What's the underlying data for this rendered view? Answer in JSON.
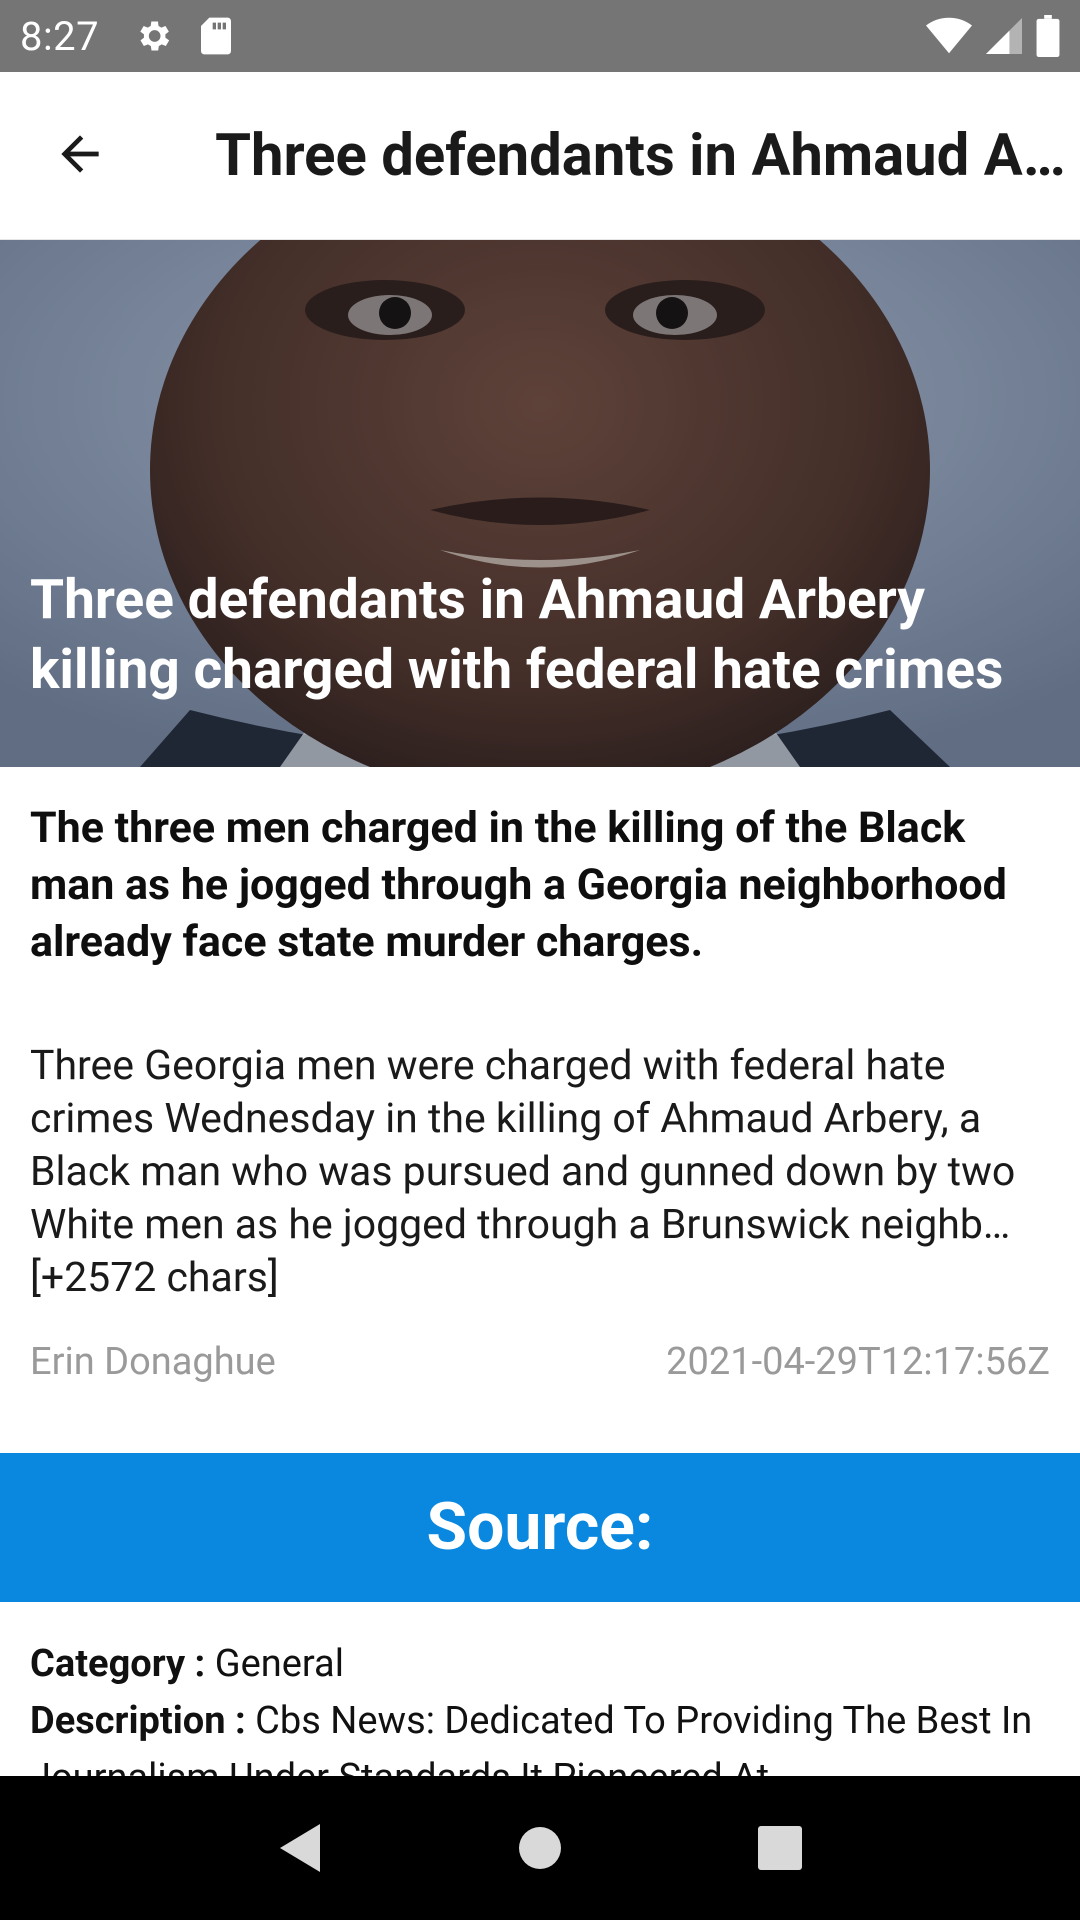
{
  "status_bar": {
    "time": "8:27",
    "icons": [
      "gear-icon",
      "sd-card-icon",
      "wifi-icon",
      "signal-icon",
      "battery-icon"
    ]
  },
  "app_bar": {
    "title": "Three defendants in Ahmaud Arbery killing charged with federal hate crimes",
    "back_icon": "arrow-back-icon"
  },
  "article": {
    "hero_title": "Three defendants in Ahmaud Arbery killing charged with federal hate crimes",
    "summary": "The three men charged in the killing of the Black man as he jogged through a Georgia neighborhood already face state murder charges.",
    "content": "Three Georgia men were charged with federal hate crimes Wednesday in the killing of Ahmaud Arbery, a Black man who was pursued and gunned down by two White men as he jogged through a Brunswick neighb… [+2572 chars]",
    "author": "Erin Donaghue",
    "published_at": "2021-04-29T12:17:56Z"
  },
  "source_button": {
    "label": "Source:"
  },
  "details": {
    "category_label": "Category : ",
    "category_value": "General",
    "description_label": "Description : ",
    "description_value": "Cbs News: Dedicated To Providing The Best In Journalism Under Standards It Pioneered At"
  },
  "colors": {
    "status_bar": "#757575",
    "accent": "#0a88e0",
    "nav_bar": "#000000",
    "meta_text": "#9a9a9a"
  },
  "nav_bar": {
    "buttons": [
      "back-triangle-icon",
      "home-circle-icon",
      "recents-square-icon"
    ]
  }
}
